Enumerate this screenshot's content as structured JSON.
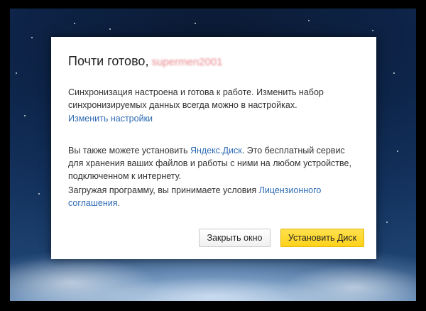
{
  "dialog": {
    "title": "Почти готово,",
    "username": "supermen2001",
    "sync_text": "Синхронизация настроена и готова к работе. Изменить набор синхронизируемых данных всегда можно в настройках.",
    "change_settings_link": "Изменить настройки",
    "disk_text_before": "Вы также можете установить ",
    "disk_link": "Яндекс.Диск",
    "disk_text_after": ". Это бесплатный сервис для хранения ваших файлов и работы с ними на любом устройстве, подключенном к интернету.",
    "license_text_before": "Загружая программу, вы принимаете условия ",
    "license_link": "Лицензионного соглашения",
    "license_text_after": ".",
    "close_button": "Закрыть окно",
    "install_button": "Установить Диск"
  },
  "colors": {
    "link": "#2f6bb3",
    "install_button": "#ffd21a",
    "username_blurred": "#e8858a"
  }
}
